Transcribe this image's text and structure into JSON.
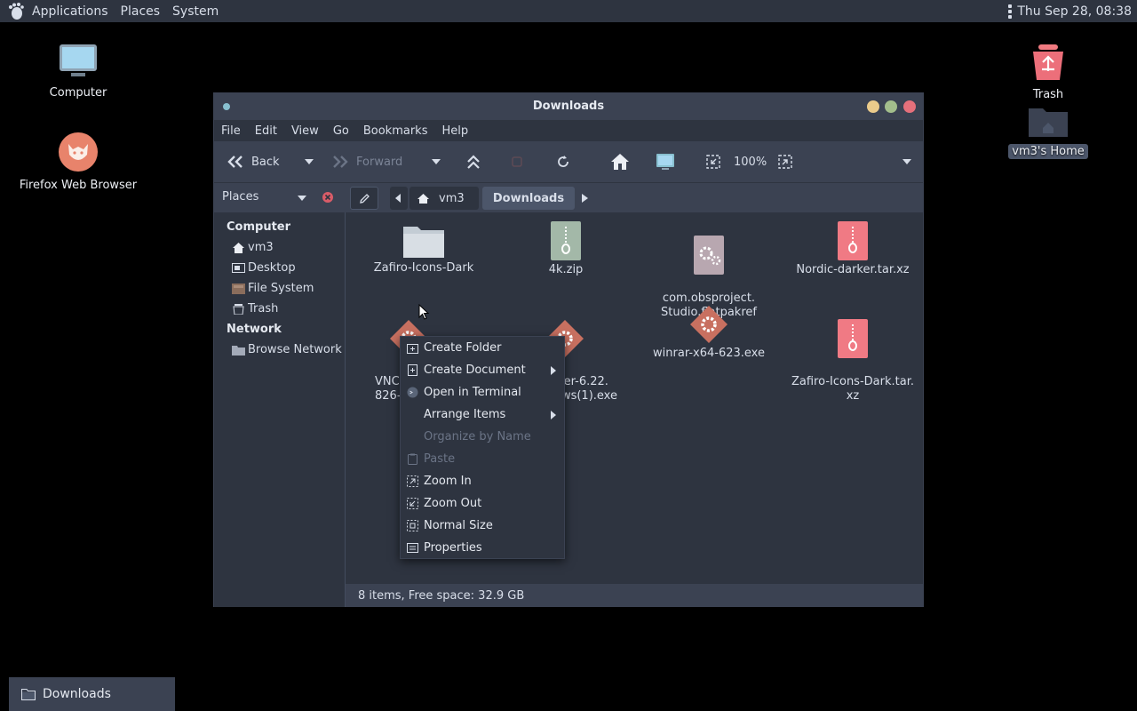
{
  "top_panel": {
    "applications": "Applications",
    "places": "Places",
    "system": "System",
    "clock": "Thu Sep 28, 08:38"
  },
  "desktop": {
    "computer": "Computer",
    "firefox": "Firefox Web Browser",
    "trash": "Trash",
    "home": "vm3's Home"
  },
  "window": {
    "title": "Downloads",
    "menu": [
      "File",
      "Edit",
      "View",
      "Go",
      "Bookmarks",
      "Help"
    ],
    "toolbar": {
      "back": "Back",
      "forward": "Forward",
      "zoom": "100%"
    },
    "places_label": "Places",
    "path": [
      "vm3",
      "Downloads"
    ],
    "sidebar": {
      "computer_header": "Computer",
      "items": [
        "vm3",
        "Desktop",
        "File System",
        "Trash"
      ],
      "network_header": "Network",
      "network_items": [
        "Browse Network"
      ]
    },
    "files": [
      {
        "name": "Zafiro-Icons-Dark",
        "kind": "folder"
      },
      {
        "name": "4k.zip",
        "kind": "zip"
      },
      {
        "name": "com.obsproject.\nStudio.flatpakref",
        "kind": "gear"
      },
      {
        "name": "Nordic-darker.tar.xz",
        "kind": "archive"
      },
      {
        "name": "VNC\n826-",
        "kind": "exe"
      },
      {
        "name": "wer-6.22.\nows(1).exe",
        "kind": "exe"
      },
      {
        "name": "winrar-x64-623.exe",
        "kind": "exe"
      },
      {
        "name": "Zafiro-Icons-Dark.tar.\nxz",
        "kind": "archive"
      }
    ],
    "status": "8 items, Free space: 32.9 GB"
  },
  "context_menu": {
    "items": [
      {
        "label": "Create Folder",
        "icon": "folder-new-icon",
        "enabled": true,
        "submenu": false
      },
      {
        "label": "Create Document",
        "icon": "document-new-icon",
        "enabled": true,
        "submenu": true
      },
      {
        "label": "Open in Terminal",
        "icon": "terminal-icon",
        "enabled": true,
        "submenu": false
      },
      {
        "label": "Arrange Items",
        "icon": "",
        "enabled": true,
        "submenu": true
      },
      {
        "label": "Organize by Name",
        "icon": "",
        "enabled": false,
        "submenu": false
      },
      {
        "label": "Paste",
        "icon": "paste-icon",
        "enabled": false,
        "submenu": false
      },
      {
        "label": "Zoom In",
        "icon": "zoom-in-icon",
        "enabled": true,
        "submenu": false
      },
      {
        "label": "Zoom Out",
        "icon": "zoom-out-icon",
        "enabled": true,
        "submenu": false
      },
      {
        "label": "Normal Size",
        "icon": "zoom-normal-icon",
        "enabled": true,
        "submenu": false
      },
      {
        "label": "Properties",
        "icon": "properties-icon",
        "enabled": true,
        "submenu": false
      }
    ]
  },
  "taskbar": {
    "task": "Downloads"
  },
  "colors": {
    "panel": "#2e3440",
    "surface": "#3b4252",
    "accent_red": "#ec6f7a",
    "text": "#d8dee9"
  }
}
